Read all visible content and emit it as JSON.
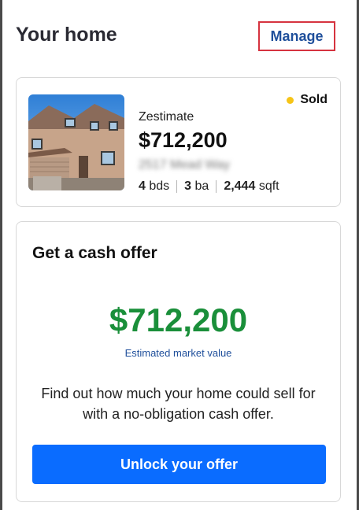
{
  "header": {
    "title": "Your home",
    "manage_label": "Manage"
  },
  "home": {
    "status": "Sold",
    "status_color": "#f6c417",
    "zestimate_label": "Zestimate",
    "price": "$712,200",
    "address": "2517 Mead Way",
    "beds_value": "4",
    "beds_unit": "bds",
    "baths_value": "3",
    "baths_unit": "ba",
    "sqft_value": "2,444",
    "sqft_unit": "sqft"
  },
  "offer": {
    "title": "Get a cash offer",
    "value": "$712,200",
    "value_label": "Estimated market value",
    "description": "Find out how much your home could sell for with a no-obligation cash offer.",
    "button_label": "Unlock your offer",
    "value_color": "#1a8f3a",
    "button_color": "#0a6cff"
  }
}
